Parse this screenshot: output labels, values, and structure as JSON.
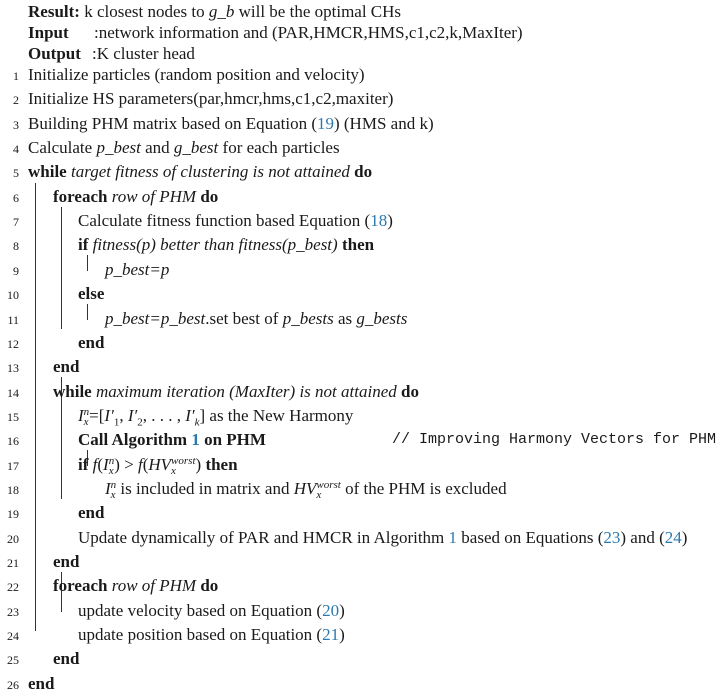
{
  "header": {
    "result_label": "Result:",
    "result_text_a": "k closest nodes to ",
    "result_var": "g_b",
    "result_text_b": " will be the optimal CHs",
    "input_label": "Input",
    "input_colon": ":",
    "input_text": "network information and (PAR,HMCR,HMS,c1,c2,k,MaxIter)",
    "output_label": "Output",
    "output_colon": ":",
    "output_text": "K cluster head"
  },
  "lines": [
    {
      "n": "1",
      "plain": "Initialize particles (random position and velocity)"
    },
    {
      "n": "2",
      "plain": "Initialize HS parameters(par,hmcr,hms,c1,c2,maxiter)"
    },
    {
      "n": "3",
      "a": "Building PHM matrix based on Equation (",
      "ref": "19",
      "b": ") (HMS and k)"
    },
    {
      "n": "4",
      "a": "Calculate ",
      "v1": "p_best",
      "b": " and ",
      "v2": "g_best",
      "c": " for each particles"
    },
    {
      "n": "5",
      "kw1": "while",
      "cond": "target fitness of clustering is not attained",
      "kw2": "do"
    },
    {
      "n": "6",
      "kw1": "foreach",
      "cond": "row of PHM",
      "kw2": "do"
    },
    {
      "n": "7",
      "a": "Calculate fitness function based Equation (",
      "ref": "18",
      "b": ")"
    },
    {
      "n": "8",
      "kw1": "if",
      "cond": "fitness(p) better than fitness(p_best)",
      "kw2": "then"
    },
    {
      "n": "9",
      "it": "p_best=p"
    },
    {
      "n": "10",
      "kw": "else"
    },
    {
      "n": "11",
      "v1": "p_best=p_best",
      "a": ".set best of ",
      "v2": "p_bests",
      "b": " as ",
      "v3": "g_bests"
    },
    {
      "n": "12",
      "kw": "end"
    },
    {
      "n": "13",
      "kw": "end"
    },
    {
      "n": "14",
      "kw1": "while",
      "cond": "maximum iteration (MaxIter) is not attained",
      "kw2": "do"
    },
    {
      "n": "15",
      "math": "I",
      "sup": "n",
      "sub": "x",
      "a": "=[",
      "p1": "I′",
      "s1": "1",
      "sep1": ", ",
      "p2": "I′",
      "s2": "2",
      "sep2": ", . . . , ",
      "p3": "I′",
      "s3": "k",
      "b": "] as the New Harmony"
    },
    {
      "n": "16",
      "kw_a": "Call Algorithm ",
      "ref": "1",
      "kw_b": " on PHM",
      "comment": "// Improving Harmony Vectors for PHM"
    },
    {
      "n": "17",
      "kw1": "if",
      "expr": "f(Iⁿₓ) > f(HVʷᵒʳˢᵗₓ)",
      "kw2": "then"
    },
    {
      "n": "18",
      "a": " is included in matrix and ",
      "b": " of the PHM is excluded"
    },
    {
      "n": "19",
      "kw": "end"
    },
    {
      "n": "20",
      "a": "Update dynamically of PAR and HMCR in Algorithm ",
      "ref1": "1",
      "b": " based on Equations (",
      "ref2": "23",
      "c": ") and (",
      "ref3": "24",
      "d": ")"
    },
    {
      "n": "21",
      "kw": "end"
    },
    {
      "n": "22",
      "kw1": "foreach",
      "cond": "row of PHM",
      "kw2": "do"
    },
    {
      "n": "23",
      "a": "update velocity based on Equation (",
      "ref": "20",
      "b": ")"
    },
    {
      "n": "24",
      "a": "update position based on Equation (",
      "ref": "21",
      "b": ")"
    },
    {
      "n": "25",
      "kw": "end"
    },
    {
      "n": "26",
      "kw": "end"
    }
  ],
  "math": {
    "I": "I",
    "n": "n",
    "x": "x",
    "HV": "HV",
    "worst": "worst",
    "f": "f",
    "gt": " > "
  },
  "colors": {
    "link": "#2a7ab0",
    "text": "#1a1a1a"
  }
}
